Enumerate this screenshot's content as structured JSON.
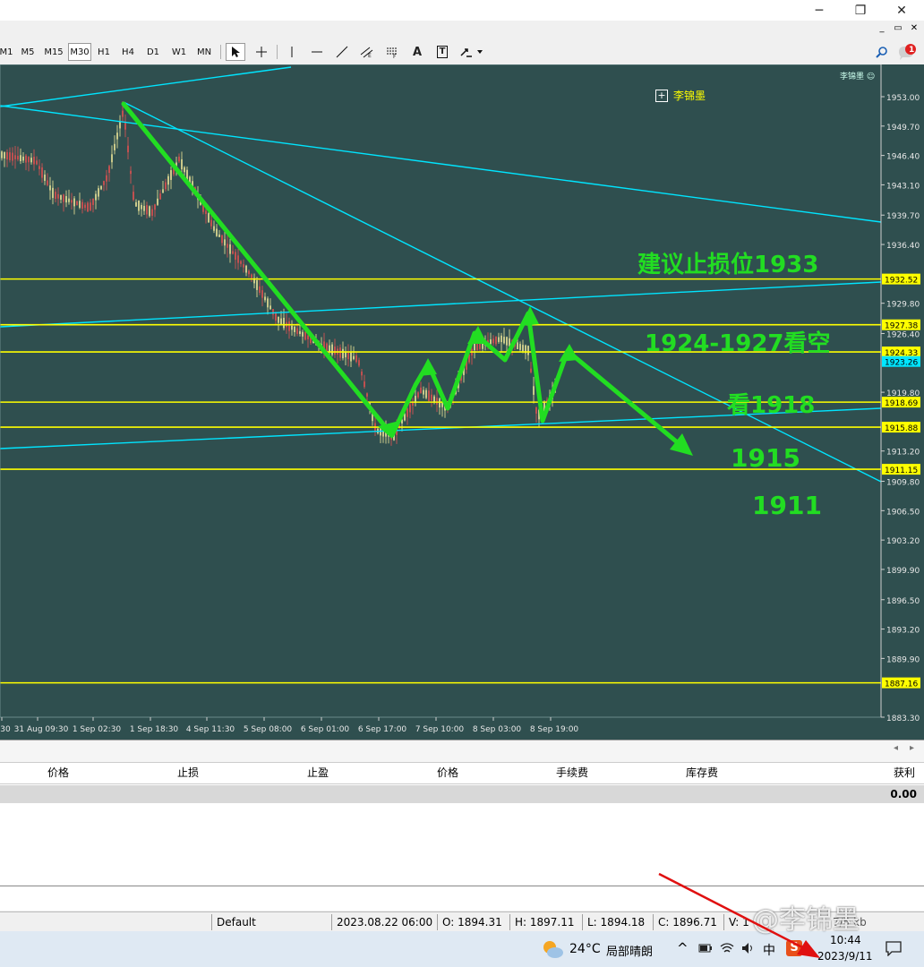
{
  "window": {
    "minimize_glyph": "─",
    "restore_glyph": "❐",
    "close_glyph": "✕",
    "inner_restore_glyph": "▭",
    "inner_close_glyph": "✕"
  },
  "toolbar": {
    "timeframes": [
      "M1",
      "M5",
      "M15",
      "M30",
      "H1",
      "H4",
      "D1",
      "W1",
      "MN"
    ],
    "active_timeframe": "M30",
    "tools": [
      "cursor-icon",
      "crosshair-icon",
      "vertical-line-icon",
      "horizontal-line-icon",
      "trendline-icon",
      "equidistant-channel-icon",
      "fibonacci-icon",
      "text-icon",
      "text-label-icon",
      "arrows-icon"
    ],
    "text_tool_label": "A",
    "label_tool_label": "T",
    "notification_count": "1"
  },
  "chart": {
    "watermark": "李锦墨",
    "legend_label": "李锦墨",
    "legend_expand": "+",
    "y_ticks": [
      "1953.00",
      "1949.70",
      "1946.40",
      "1943.10",
      "1939.70",
      "1936.40",
      "1929.80",
      "1926.40",
      "1919.80",
      "1913.20",
      "1909.80",
      "1906.50",
      "1903.20",
      "1899.90",
      "1896.50",
      "1893.20",
      "1889.90",
      "1883.30"
    ],
    "price_tags": [
      {
        "label": "1932.52",
        "color": "#ffff00"
      },
      {
        "label": "1927.38",
        "color": "#ffff00"
      },
      {
        "label": "1924.33",
        "color": "#ffff00"
      },
      {
        "label": "1923.26",
        "color": "#00e5ff"
      },
      {
        "label": "1918.69",
        "color": "#ffff00"
      },
      {
        "label": "1915.88",
        "color": "#ffff00"
      },
      {
        "label": "1911.15",
        "color": "#ffff00"
      },
      {
        "label": "1887.16",
        "color": "#ffff00"
      }
    ],
    "x_ticks": [
      "30",
      "31 Aug 09:30",
      "1 Sep 02:30",
      "1 Sep 18:30",
      "4 Sep 11:30",
      "5 Sep 08:00",
      "6 Sep 01:00",
      "6 Sep 17:00",
      "7 Sep 10:00",
      "8 Sep 03:00",
      "8 Sep 19:00"
    ],
    "annotations": {
      "stop_loss": "建议止损位1933",
      "sell_zone": "1924-1927看空",
      "target_1918": "看1918",
      "target_1915": "1915",
      "target_1911": "1911"
    },
    "colors": {
      "background": "#2f4f4f",
      "level_line": "#ffff00",
      "trend_line": "#00e5ff",
      "annotation": "#22dd22",
      "candle_up": "#c9c98a",
      "candle_down": "#c05050"
    }
  },
  "terminal": {
    "columns": [
      "价格",
      "止损",
      "止盈",
      "价格",
      "手续费",
      "库存费",
      "获利"
    ],
    "total_profit": "0.00"
  },
  "statusbar": {
    "profile": "Default",
    "datetime": "2023.08.22 06:00",
    "open": "O: 1894.31",
    "high": "H: 1897.11",
    "low": "L: 1894.18",
    "close": "C: 1896.71",
    "volume": "V: 1",
    "traffic": "7/5 kb"
  },
  "taskbar": {
    "temperature": "24°C",
    "weather": "局部晴朗",
    "ime_label": "中",
    "sogou_label": "S",
    "time": "10:44",
    "date": "2023/9/11",
    "watermark": "@李锦墨"
  }
}
